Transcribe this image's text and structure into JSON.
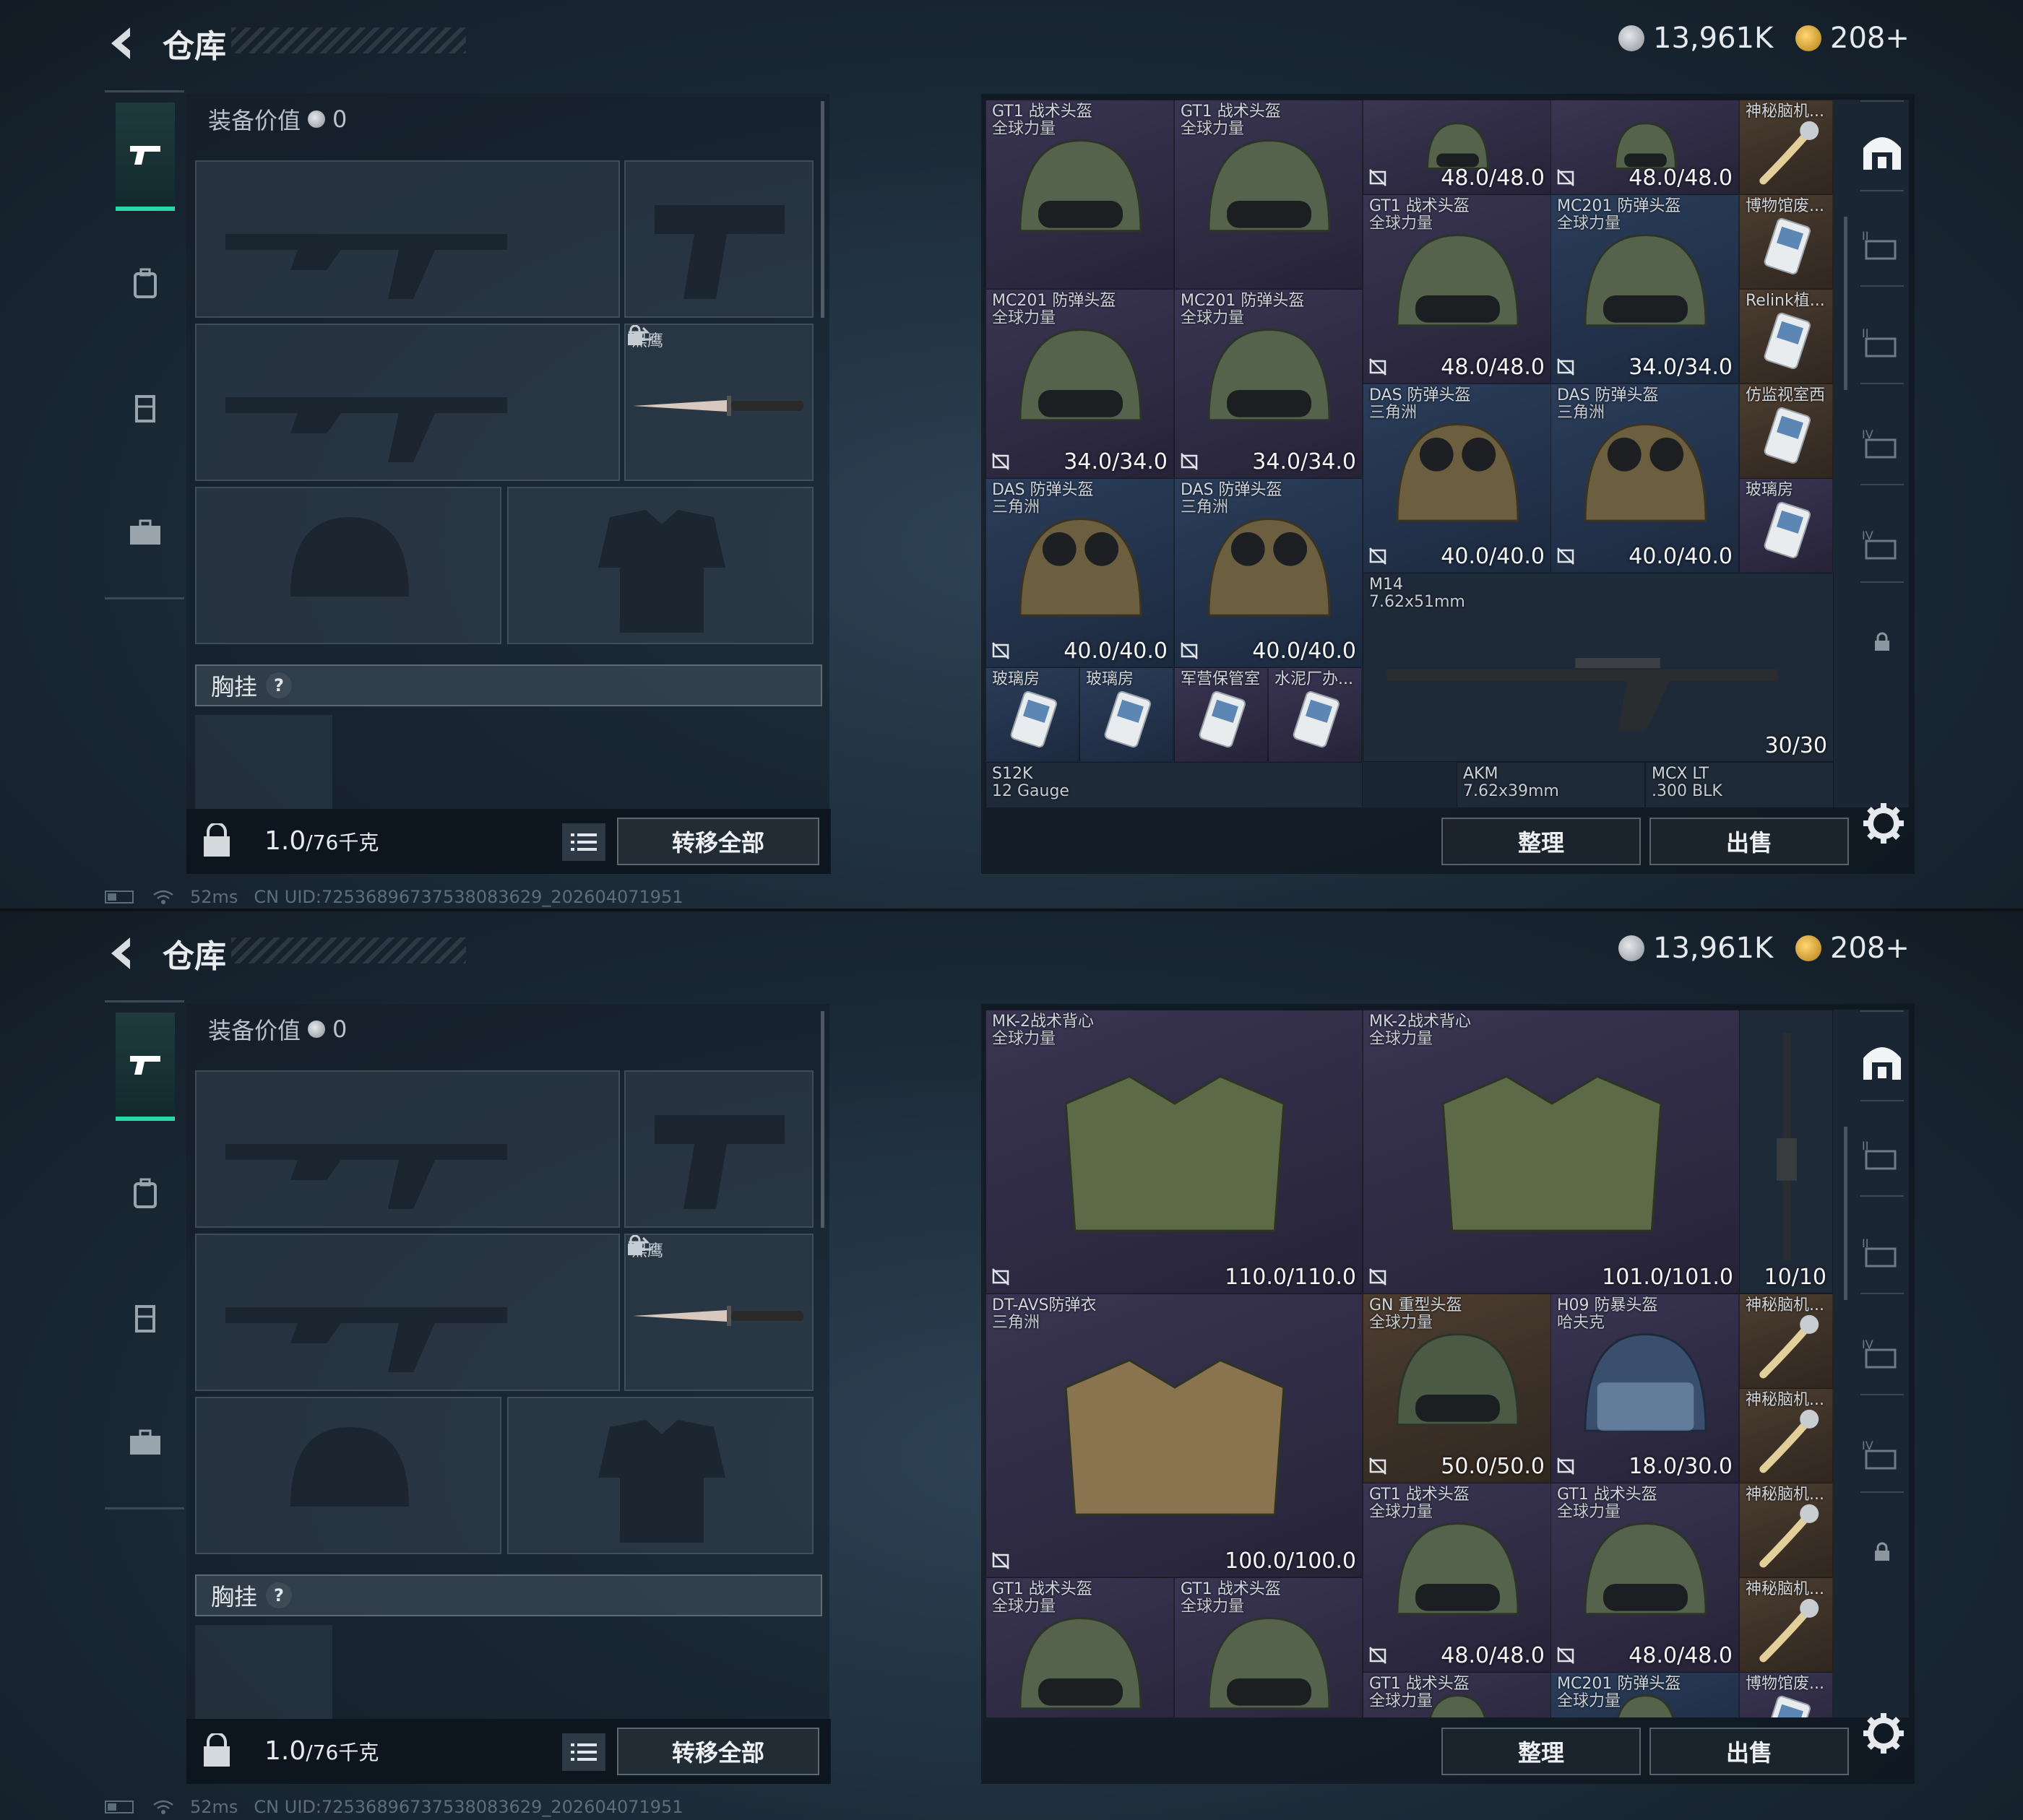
{
  "screens": [
    {
      "header": {
        "title": "仓库",
        "silver": "13,961K",
        "gold": "208+"
      },
      "equip": {
        "value_label": "装备价值",
        "value": "0",
        "melee_name": "黑鹰",
        "chest_label": "胸挂",
        "chest_help": "?",
        "weight": "1.0",
        "weight_max": "/76千克",
        "transfer_label": "转移全部"
      },
      "actions": {
        "tidy": "整理",
        "sell": "出售"
      },
      "status": {
        "ping": "52ms",
        "uid": "CN UID:72536896737538083629_202604071951"
      },
      "colors": {
        "accent": "#2bd6a8",
        "rarity_blue": "#2b3d5a",
        "rarity_purple": "#3a3552",
        "rarity_gold": "#4c3d31"
      },
      "items": [
        {
          "name": "GT1 战术头盔",
          "sub": "全球力量",
          "dur": "",
          "icon": "tactical-helmet"
        },
        {
          "name": "GT1 战术头盔",
          "sub": "全球力量",
          "dur": "",
          "icon": "tactical-helmet"
        },
        {
          "name": "",
          "sub": "",
          "dur": "48.0/48.0",
          "icon": "tactical-helmet"
        },
        {
          "name": "",
          "sub": "",
          "dur": "48.0/48.0",
          "icon": "tactical-helmet"
        },
        {
          "name": "神秘脑机...",
          "sub": "",
          "dur": "",
          "icon": "brain-chip"
        },
        {
          "name": "",
          "sub": "",
          "dur": "48.0/48.0",
          "icon": ""
        },
        {
          "name": "",
          "sub": "",
          "dur": "48.0/48.0",
          "icon": ""
        },
        {
          "name": "GT1 战术头盔",
          "sub": "全球力量",
          "dur": "48.0/48.0",
          "icon": "tactical-helmet"
        },
        {
          "name": "MC201 防弹头盔",
          "sub": "全球力量",
          "dur": "34.0/34.0",
          "icon": "ballistic-helmet"
        },
        {
          "name": "博物馆废...",
          "sub": "",
          "dur": "",
          "icon": "keycard"
        },
        {
          "name": "MC201 防弹头盔",
          "sub": "全球力量",
          "dur": "34.0/34.0",
          "icon": "ballistic-helmet"
        },
        {
          "name": "MC201 防弹头盔",
          "sub": "全球力量",
          "dur": "34.0/34.0",
          "icon": "ballistic-helmet"
        },
        {
          "name": "Relink植...",
          "sub": "",
          "dur": "",
          "icon": "keycard"
        },
        {
          "name": "DAS 防弹头盔",
          "sub": "三角洲",
          "dur": "40.0/40.0",
          "icon": "goggle-helmet"
        },
        {
          "name": "DAS 防弹头盔",
          "sub": "三角洲",
          "dur": "40.0/40.0",
          "icon": "goggle-helmet"
        },
        {
          "name": "仿监视室西",
          "sub": "",
          "dur": "",
          "icon": "keycard"
        },
        {
          "name": "DAS 防弹头盔",
          "sub": "三角洲",
          "dur": "40.0/40.0",
          "icon": "goggle-helmet"
        },
        {
          "name": "DAS 防弹头盔",
          "sub": "三角洲",
          "dur": "40.0/40.0",
          "icon": "goggle-helmet"
        },
        {
          "name": "玻璃房",
          "sub": "",
          "dur": "",
          "icon": "keycard"
        },
        {
          "name": "M14",
          "sub": "7.62x51mm",
          "dur": "30/30",
          "icon": "rifle"
        },
        {
          "name": "玻璃房",
          "sub": "",
          "dur": "",
          "icon": "keycard"
        },
        {
          "name": "玻璃房",
          "sub": "",
          "dur": "",
          "icon": "keycard"
        },
        {
          "name": "军营保管室",
          "sub": "",
          "dur": "",
          "icon": "keycard"
        },
        {
          "name": "水泥厂办...",
          "sub": "",
          "dur": "",
          "icon": "keycard"
        },
        {
          "name": "S12K",
          "sub": "12 Gauge",
          "dur": "",
          "icon": ""
        },
        {
          "name": "AKM",
          "sub": "7.62x39mm",
          "dur": "",
          "icon": ""
        },
        {
          "name": "MCX LT",
          "sub": ".300 BLK",
          "dur": "",
          "icon": ""
        }
      ]
    },
    {
      "header": {
        "title": "仓库",
        "silver": "13,961K",
        "gold": "208+"
      },
      "equip": {
        "value_label": "装备价值",
        "value": "0",
        "melee_name": "黑鹰",
        "chest_label": "胸挂",
        "chest_help": "?",
        "weight": "1.0",
        "weight_max": "/76千克",
        "transfer_label": "转移全部"
      },
      "actions": {
        "tidy": "整理",
        "sell": "出售"
      },
      "status": {
        "ping": "52ms",
        "uid": "CN UID:72536896737538083629_202604071951"
      },
      "items": [
        {
          "name": "MK-2战术背心",
          "sub": "全球力量",
          "dur": "110.0/110.0",
          "icon": "tactical-vest"
        },
        {
          "name": "MK-2战术背心",
          "sub": "全球力量",
          "dur": "101.0/101.0",
          "icon": "tactical-vest"
        },
        {
          "name": "",
          "sub": "",
          "dur": "10/10",
          "icon": "rifle"
        },
        {
          "name": "DT-AVS防弹衣",
          "sub": "三角洲",
          "dur": "100.0/100.0",
          "icon": "body-armor"
        },
        {
          "name": "GN 重型头盔",
          "sub": "全球力量",
          "dur": "50.0/50.0",
          "icon": "heavy-helmet"
        },
        {
          "name": "H09 防暴头盔",
          "sub": "哈夫克",
          "dur": "18.0/30.0",
          "icon": "riot-helmet"
        },
        {
          "name": "神秘脑机...",
          "sub": "",
          "dur": "",
          "icon": "brain-chip"
        },
        {
          "name": "神秘脑机...",
          "sub": "",
          "dur": "",
          "icon": "brain-chip"
        },
        {
          "name": "GT1 战术头盔",
          "sub": "全球力量",
          "dur": "48.0/48.0",
          "icon": "tactical-helmet"
        },
        {
          "name": "GT1 战术头盔",
          "sub": "全球力量",
          "dur": "48.0/48.0",
          "icon": "tactical-helmet"
        },
        {
          "name": "神秘脑机...",
          "sub": "",
          "dur": "",
          "icon": "brain-chip"
        },
        {
          "name": "神秘脑机...",
          "sub": "",
          "dur": "",
          "icon": "brain-chip"
        },
        {
          "name": "GT1 战术头盔",
          "sub": "全球力量",
          "dur": "",
          "icon": "tactical-helmet"
        },
        {
          "name": "GT1 战术头盔",
          "sub": "全球力量",
          "dur": "",
          "icon": "tactical-helmet"
        },
        {
          "name": "GT1 战术头盔",
          "sub": "全球力量",
          "dur": "",
          "icon": "tactical-helmet"
        },
        {
          "name": "MC201 防弹头盔",
          "sub": "全球力量",
          "dur": "",
          "icon": "ballistic-helmet"
        },
        {
          "name": "博物馆废...",
          "sub": "",
          "dur": "",
          "icon": "keycard"
        }
      ]
    }
  ]
}
